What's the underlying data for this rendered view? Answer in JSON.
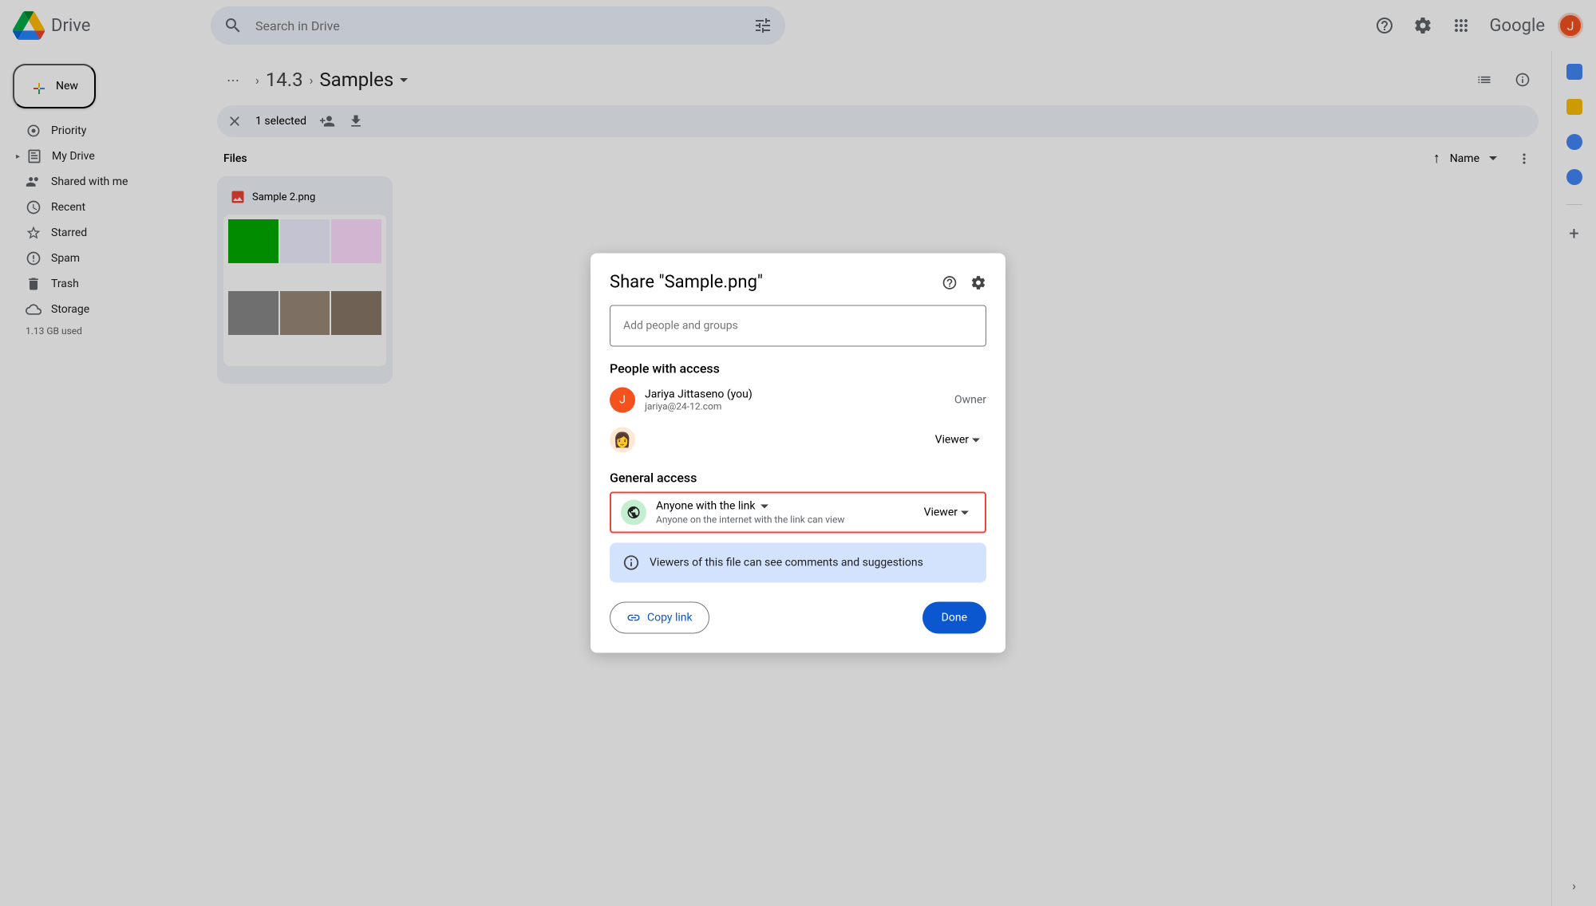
{
  "header": {
    "product": "Drive",
    "search_placeholder": "Search in Drive",
    "google": "Google",
    "avatar_initial": "J"
  },
  "sidebar": {
    "new_label": "New",
    "items": [
      {
        "label": "Priority"
      },
      {
        "label": "My Drive"
      },
      {
        "label": "Shared with me"
      },
      {
        "label": "Recent"
      },
      {
        "label": "Starred"
      },
      {
        "label": "Spam"
      },
      {
        "label": "Trash"
      },
      {
        "label": "Storage"
      }
    ],
    "storage_used": "1.13 GB used"
  },
  "breadcrumb": {
    "parent": "14.3",
    "current": "Samples"
  },
  "selection": {
    "count_text": "1 selected"
  },
  "files": {
    "section_label": "Files",
    "sort_label": "Name",
    "card_name": "Sample 2.png"
  },
  "modal": {
    "title": "Share \"Sample.png\"",
    "add_placeholder": "Add people and groups",
    "people_title": "People with access",
    "owner": {
      "name": "Jariya Jittaseno (you)",
      "email": "jariya@24-12.com",
      "role": "Owner",
      "initial": "J"
    },
    "viewer_role": "Viewer",
    "general_title": "General access",
    "link_access": "Anyone with the link",
    "link_sub": "Anyone on the internet with the link can view",
    "link_role": "Viewer",
    "info_text": "Viewers of this file can see comments and suggestions",
    "copy_label": "Copy link",
    "done_label": "Done"
  }
}
